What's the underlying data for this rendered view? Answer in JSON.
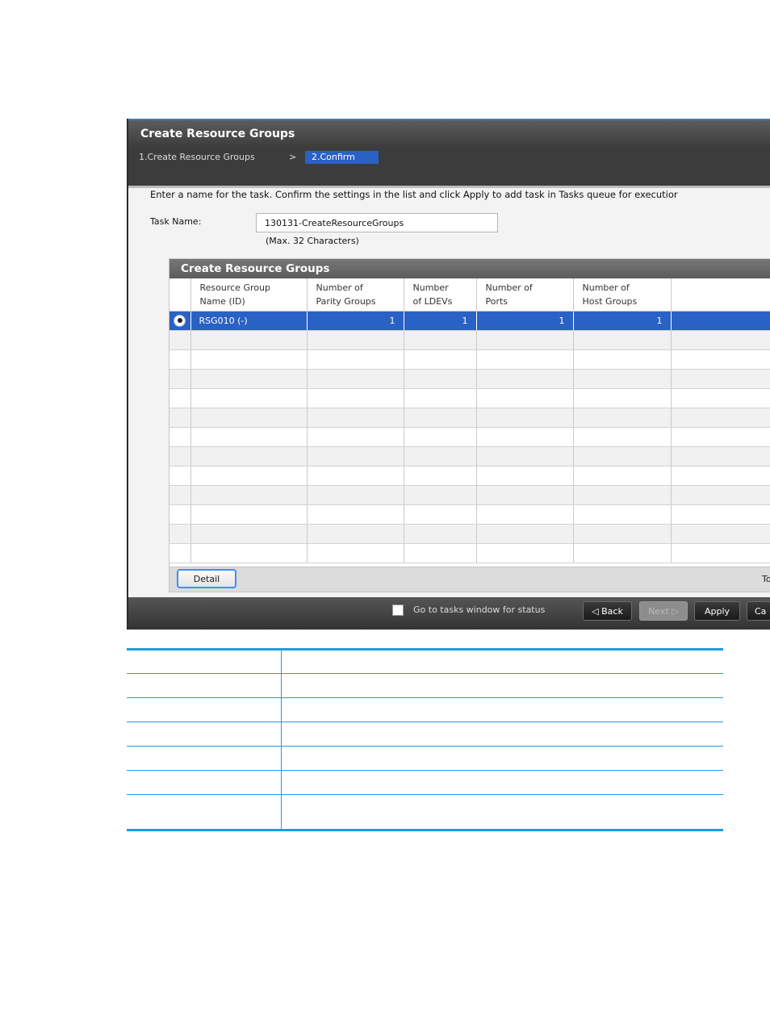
{
  "window": {
    "title": "Create Resource Groups",
    "steps": [
      "1.Create Resource Groups",
      "2.Confirm"
    ],
    "step_separator": ">",
    "instruction": "Enter a name for the task. Confirm the settings in the list and click Apply to add task in Tasks queue for executior"
  },
  "task_name": {
    "label": "Task Name:",
    "value": "130131-CreateResourceGroups",
    "hint": "(Max. 32 Characters)"
  },
  "panel": {
    "title": "Create Resource Groups",
    "columns": [
      "Resource Group\nName (ID)",
      "Number of\nParity Groups",
      "Number\nof LDEVs",
      "Number of\nPorts",
      "Number of\nHost Groups",
      ""
    ],
    "rows": [
      {
        "name": "RSG010 (-)",
        "parity_groups": "1",
        "ldevs": "1",
        "ports": "1",
        "host_groups": "1"
      }
    ],
    "detail_button": "Detail",
    "footer_text": "To"
  },
  "bottom_bar": {
    "checkbox_label": "Go to tasks window for status",
    "back_button": "◁ Back",
    "next_button": "Next ▷",
    "apply_button": "Apply",
    "cancel_button": "Ca"
  },
  "colors": {
    "accent": "#2a61c4",
    "title_stripe": "#2f84d8",
    "doc_rule": "#1e9de4"
  }
}
